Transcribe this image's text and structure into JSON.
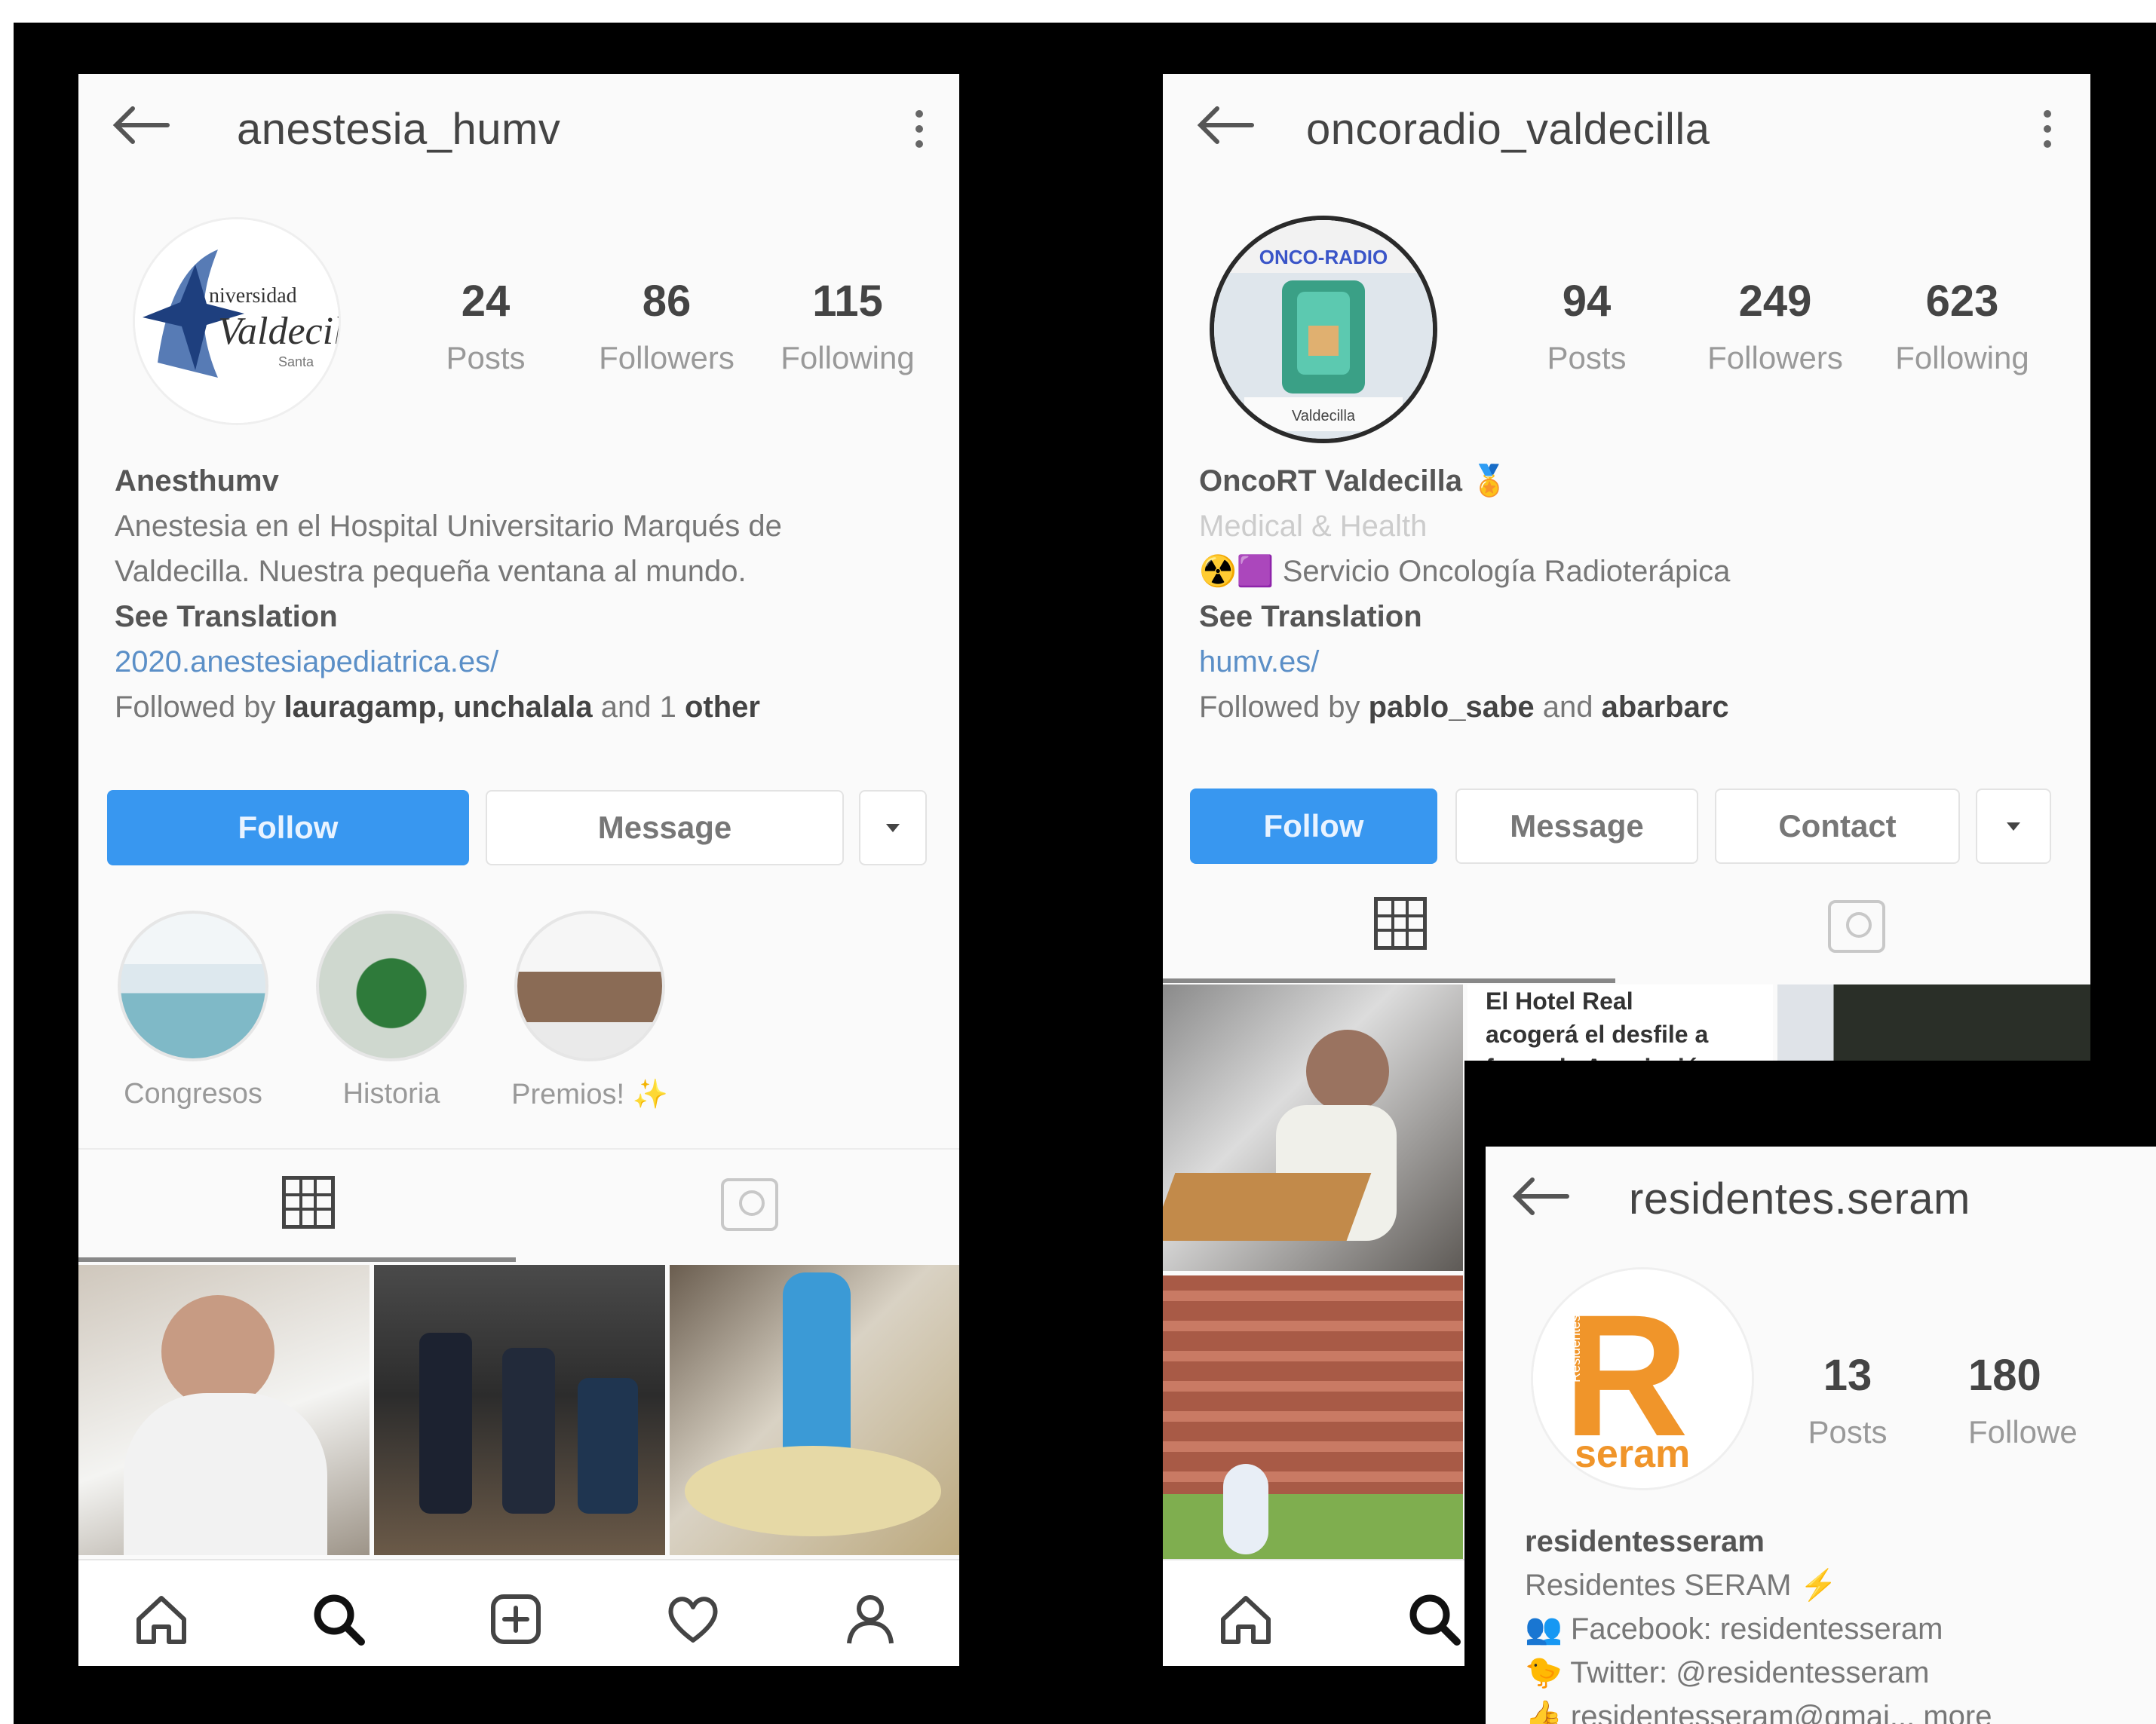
{
  "profiles": [
    {
      "username": "anestesia_humv",
      "stats": [
        {
          "value": "24",
          "label": "Posts"
        },
        {
          "value": "86",
          "label": "Followers"
        },
        {
          "value": "115",
          "label": "Following"
        }
      ],
      "avatar_text": [
        "niversidad",
        "Valdecill",
        "Santa"
      ],
      "name": "Anesthumv",
      "bio_lines": [
        "Anestesia en el Hospital Universitario Marqués de",
        "Valdecilla. Nuestra pequeña ventana al mundo."
      ],
      "see_translation": "See Translation",
      "link": "2020.anestesiapediatrica.es/",
      "followed_by_prefix": "Followed by",
      "followed_by_names": "lauragamp, unchalala",
      "followed_by_and": "and 1",
      "followed_by_suffix": "other",
      "buttons": {
        "follow": "Follow",
        "message": "Message"
      },
      "highlights": [
        "Congresos",
        "Historia",
        "Premios! ✨"
      ]
    },
    {
      "username": "oncoradio_valdecilla",
      "stats": [
        {
          "value": "94",
          "label": "Posts"
        },
        {
          "value": "249",
          "label": "Followers"
        },
        {
          "value": "623",
          "label": "Following"
        }
      ],
      "avatar_text": [
        "ONCO-RADIO",
        "Valdecilla"
      ],
      "name": "OncoRT Valdecilla 🏅",
      "category": "Medical & Health",
      "bio_lines": [
        "☢️🟪 Servicio Oncología Radioterápica"
      ],
      "see_translation": "See Translation",
      "link": "humv.es/",
      "followed_by_prefix": "Followed by",
      "followed_by_names": "pablo_sabe",
      "followed_by_and": "and",
      "followed_by_suffix": "abarbarc",
      "buttons": {
        "follow": "Follow",
        "message": "Message",
        "contact": "Contact"
      },
      "post_caption_lines": [
        "El Hotel Real",
        "acogerá el desfile a",
        "favor de Asociación"
      ]
    },
    {
      "username": "residentes.seram",
      "stats": [
        {
          "value": "13",
          "label": "Posts"
        },
        {
          "value": "180",
          "label": "Followe"
        }
      ],
      "avatar_text": [
        "R",
        "Residentes",
        "seram"
      ],
      "name": "residentesseram",
      "bio_lines": [
        "Residentes SERAM ⚡",
        "👥 Facebook: residentesseram",
        "🐤 Twitter: @residentesseram",
        "👍 residentesseram@gmai... more"
      ]
    }
  ],
  "colors": {
    "follow_blue": "#3897f0",
    "link_blue": "#5b8fc7",
    "seram_orange": "#f0952a",
    "frame_black": "#000000"
  },
  "icons": [
    "back-arrow-icon",
    "more-options-icon",
    "caret-down-icon",
    "grid-icon",
    "tagged-icon",
    "home-icon",
    "search-icon",
    "new-post-icon",
    "heart-icon",
    "profile-icon"
  ]
}
